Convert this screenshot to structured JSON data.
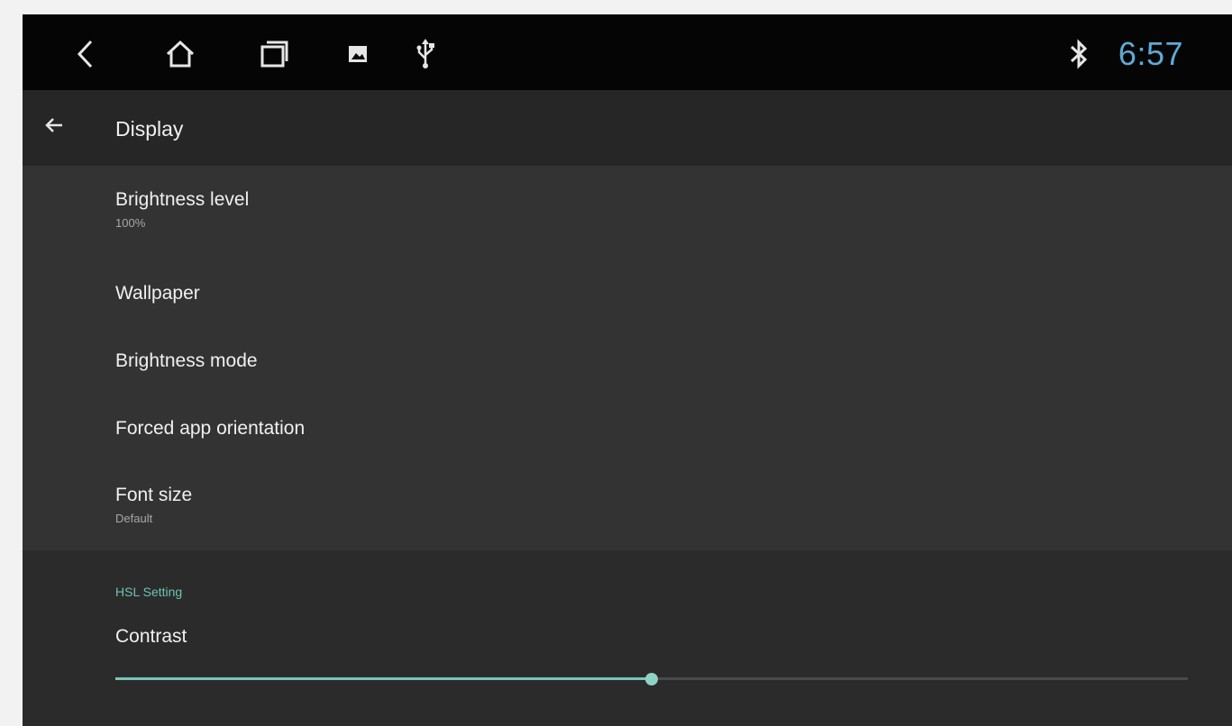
{
  "status_bar": {
    "clock": "6:57",
    "icons": [
      "back-chevron-icon",
      "home-icon",
      "recents-icon",
      "image-icon",
      "usb-icon",
      "bluetooth-icon"
    ],
    "clock_color": "#5fa9d6"
  },
  "app_bar": {
    "title": "Display"
  },
  "settings": {
    "items": [
      {
        "label": "Brightness level",
        "sub": "100%"
      },
      {
        "label": "Wallpaper",
        "sub": ""
      },
      {
        "label": "Brightness mode",
        "sub": ""
      },
      {
        "label": "Forced app orientation",
        "sub": ""
      },
      {
        "label": "Font size",
        "sub": "Default"
      }
    ]
  },
  "hsl_section": {
    "title": "HSL Setting",
    "contrast_label": "Contrast",
    "contrast_value": 0.5,
    "accent_color": "#6cc3b4"
  }
}
